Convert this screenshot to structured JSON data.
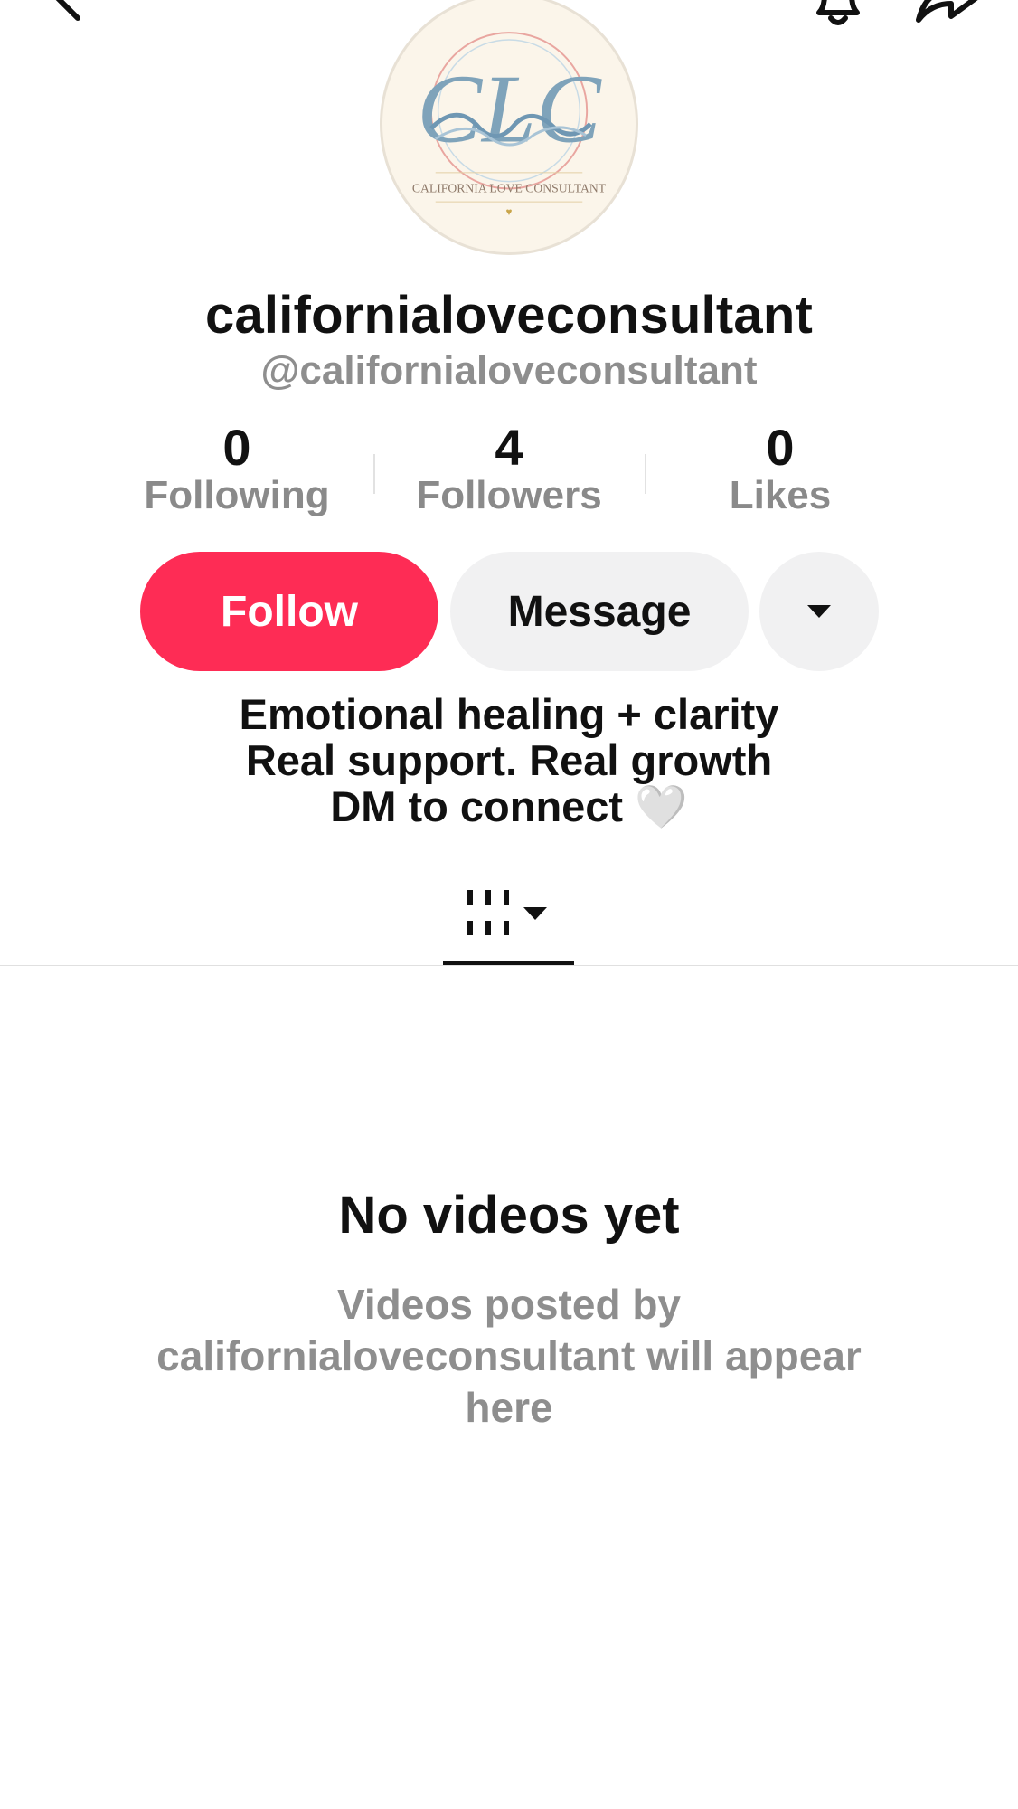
{
  "profile": {
    "display_name": "californialoveconsultant",
    "handle": "@californialoveconsultant",
    "avatar_logo": {
      "monogram": "CLC",
      "caption": "CALIFORNIA LOVE CONSULTANT"
    }
  },
  "stats": [
    {
      "value": "0",
      "label": "Following"
    },
    {
      "value": "4",
      "label": "Followers"
    },
    {
      "value": "0",
      "label": "Likes"
    }
  ],
  "actions": {
    "follow_label": "Follow",
    "message_label": "Message"
  },
  "bio": {
    "line1": "Emotional healing + clarity",
    "line2": "Real support. Real growth",
    "line3": "DM to connect",
    "emoji": "🤍"
  },
  "empty_state": {
    "title": "No videos yet",
    "description": "Videos posted by californialoveconsultant will appear here"
  },
  "colors": {
    "follow_button": "#fe2c55",
    "secondary_button": "#f1f1f2",
    "muted_text": "#8e8e8e"
  },
  "icons": [
    "back-arrow-icon",
    "bell-icon",
    "share-icon",
    "grid-icon",
    "caret-down-icon"
  ]
}
